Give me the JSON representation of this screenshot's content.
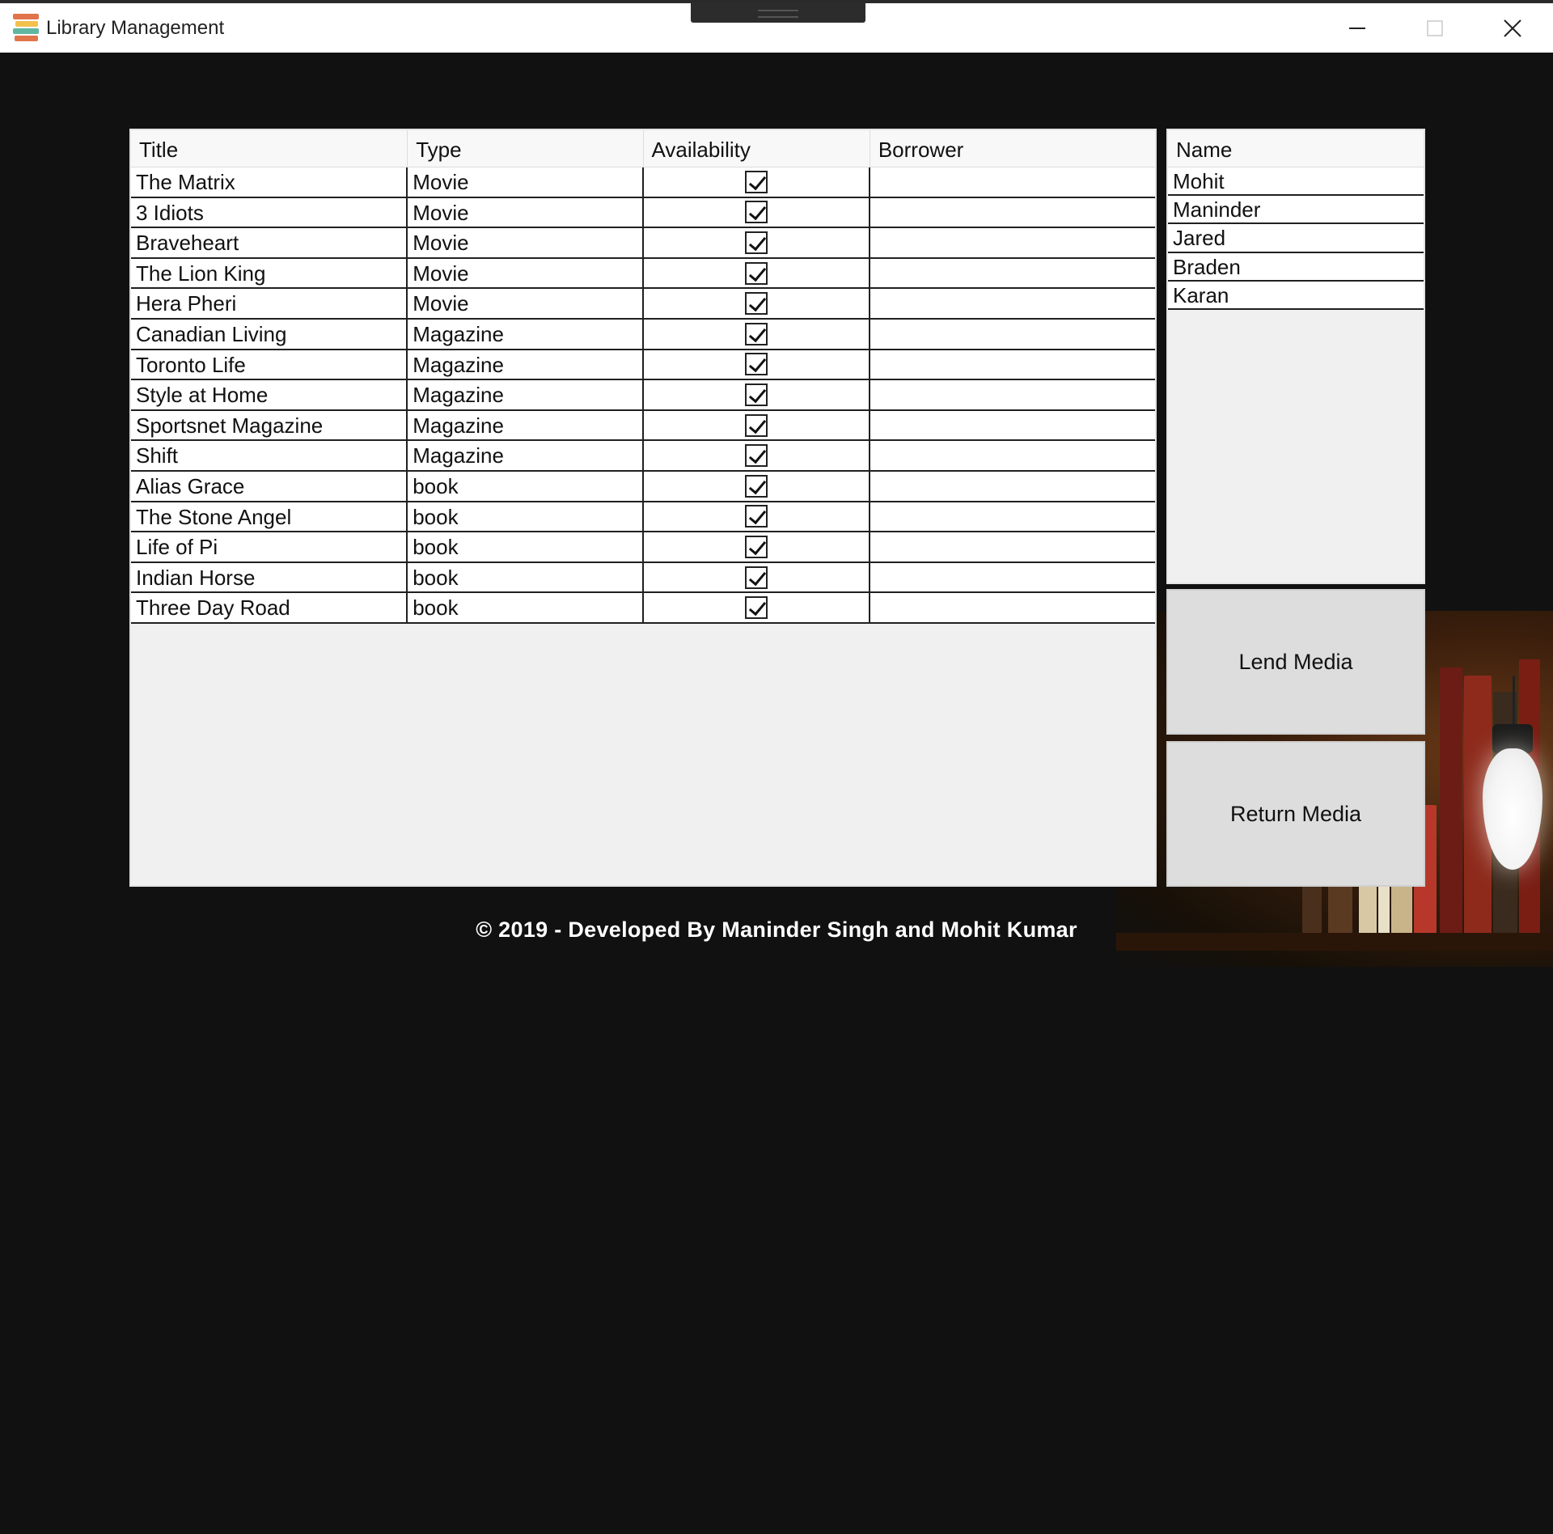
{
  "window": {
    "title": "Library Management",
    "icons": {
      "app": "books-stack-icon",
      "minimize": "minimize-icon",
      "maximize": "maximize-icon",
      "close": "close-icon"
    }
  },
  "media_table": {
    "columns": [
      "Title",
      "Type",
      "Availability",
      "Borrower"
    ],
    "rows": [
      {
        "title": "The Matrix",
        "type": "Movie",
        "available": true,
        "borrower": ""
      },
      {
        "title": "3 Idiots",
        "type": "Movie",
        "available": true,
        "borrower": ""
      },
      {
        "title": "Braveheart",
        "type": "Movie",
        "available": true,
        "borrower": ""
      },
      {
        "title": "The Lion King",
        "type": "Movie",
        "available": true,
        "borrower": ""
      },
      {
        "title": "Hera Pheri",
        "type": "Movie",
        "available": true,
        "borrower": ""
      },
      {
        "title": "Canadian Living",
        "type": "Magazine",
        "available": true,
        "borrower": ""
      },
      {
        "title": "Toronto Life",
        "type": "Magazine",
        "available": true,
        "borrower": ""
      },
      {
        "title": "Style at Home",
        "type": "Magazine",
        "available": true,
        "borrower": ""
      },
      {
        "title": "Sportsnet Magazine",
        "type": "Magazine",
        "available": true,
        "borrower": ""
      },
      {
        "title": "Shift",
        "type": "Magazine",
        "available": true,
        "borrower": ""
      },
      {
        "title": "Alias Grace",
        "type": "book",
        "available": true,
        "borrower": ""
      },
      {
        "title": "The Stone Angel",
        "type": "book",
        "available": true,
        "borrower": ""
      },
      {
        "title": "Life of Pi",
        "type": "book",
        "available": true,
        "borrower": ""
      },
      {
        "title": "Indian Horse",
        "type": "book",
        "available": true,
        "borrower": ""
      },
      {
        "title": "Three Day Road",
        "type": "book",
        "available": true,
        "borrower": ""
      }
    ]
  },
  "borrowers": {
    "header": "Name",
    "names": [
      "Mohit",
      "Maninder",
      "Jared",
      "Braden",
      "Karan"
    ]
  },
  "actions": {
    "lend_label": "Lend Media",
    "return_label": "Return Media"
  },
  "footer": {
    "text": "© 2019 - Developed By Maninder Singh and Mohit Kumar"
  },
  "colors": {
    "background": "#111111",
    "titlebar": "#ffffff",
    "grid_background": "#f0f0f0",
    "button": "#dddddd"
  }
}
